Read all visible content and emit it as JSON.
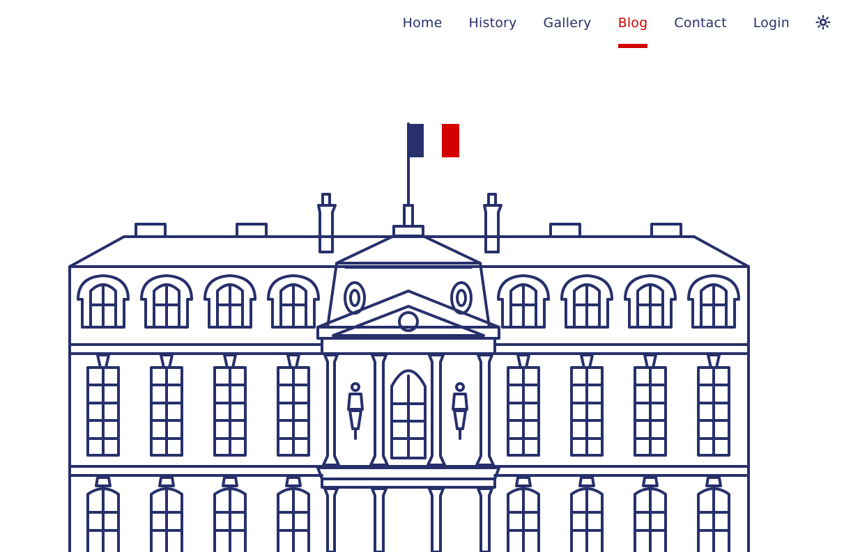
{
  "nav": {
    "items": [
      {
        "label": "Home",
        "active": false
      },
      {
        "label": "History",
        "active": false
      },
      {
        "label": "Gallery",
        "active": false
      },
      {
        "label": "Blog",
        "active": true
      },
      {
        "label": "Contact",
        "active": false
      },
      {
        "label": "Login",
        "active": false
      }
    ],
    "theme_toggle_icon": "sun-icon"
  },
  "colors": {
    "navy": "#27306b",
    "red": "#d40000",
    "flag_blue": "#27306b",
    "flag_red": "#d40000",
    "background": "#ffffff"
  },
  "illustration": {
    "subject": "palace-facade-icon"
  }
}
